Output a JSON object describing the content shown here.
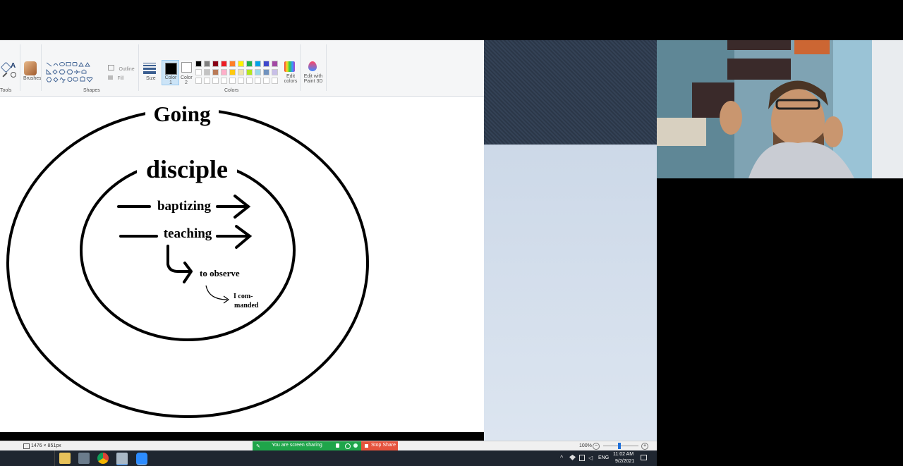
{
  "paint": {
    "ribbon": {
      "tools_label": "Tools",
      "brushes_label": "Brushes",
      "shapes_label": "Shapes",
      "outline_label": "Outline",
      "fill_label": "Fill",
      "size_label": "Size",
      "color1_label": "Color 1",
      "color2_label": "Color 2",
      "colors_label": "Colors",
      "edit_colors_label": "Edit colors",
      "edit_paint3d_label": "Edit with Paint 3D"
    },
    "palette": [
      "#000000",
      "#7f7f7f",
      "#880015",
      "#ed1c24",
      "#ff7f27",
      "#fff200",
      "#22b14c",
      "#00a2e8",
      "#3f48cc",
      "#a349a4",
      "#ffffff",
      "#c3c3c3",
      "#b97a57",
      "#ffaec9",
      "#ffc90e",
      "#efe4b0",
      "#b5e61d",
      "#99d9ea",
      "#7092be",
      "#c8bfe7"
    ],
    "drawing": {
      "outer_label": "Going",
      "inner_label": "disciple",
      "arrow1_label": "baptizing",
      "arrow2_label": "teaching",
      "observe_label": "to observe",
      "commanded_line1": "I com-",
      "commanded_line2": "manded"
    },
    "status": {
      "dimensions": "1476 × 851px",
      "zoom": "100%"
    }
  },
  "share": {
    "message": "You are screen sharing",
    "stop_label": "Stop Share"
  },
  "taskbar": {
    "language": "ENG",
    "time": "11:02 AM",
    "date": "9/2/2021"
  },
  "colors": {
    "accent": "#00a2e8",
    "share_green": "#1fa54a",
    "stop_red": "#e5533d"
  }
}
